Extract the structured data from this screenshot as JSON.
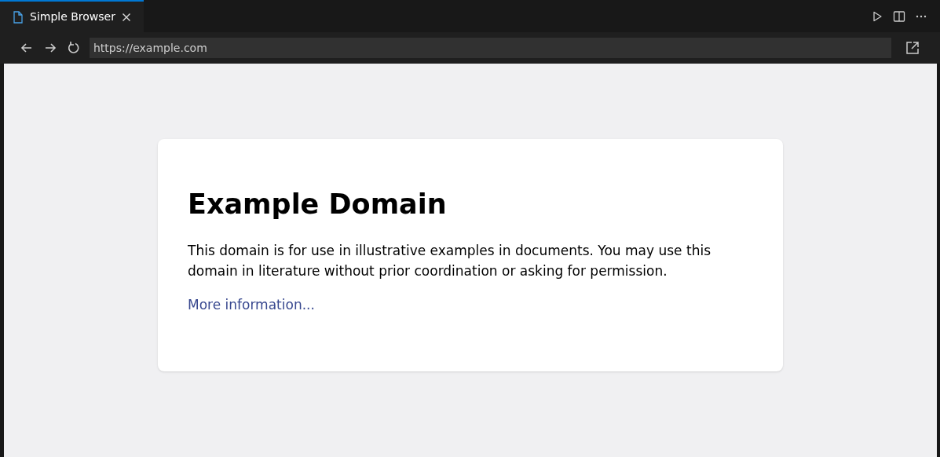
{
  "tabs": [
    {
      "label": "Simple Browser",
      "selected": true
    }
  ],
  "address_bar": {
    "value": "https://example.com"
  },
  "page": {
    "heading": "Example Domain",
    "paragraph": "This domain is for use in illustrative examples in documents. You may use this domain in literature without prior coordination or asking for permission.",
    "link": "More information..."
  }
}
